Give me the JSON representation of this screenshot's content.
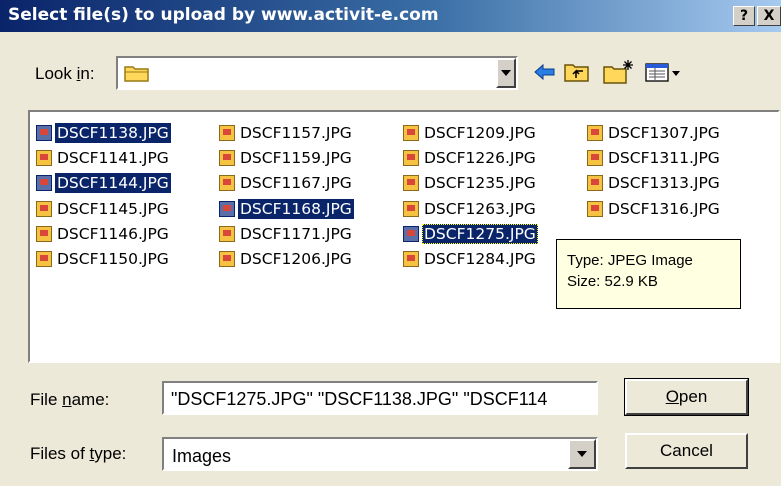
{
  "window": {
    "title": "Select file(s) to upload by www.activit-e.com",
    "help_glyph": "?",
    "close_glyph": "X"
  },
  "toolbar": {
    "look_in_pre": "Look ",
    "look_in_mn": "i",
    "look_in_post": "n:",
    "look_in_value": ""
  },
  "files": [
    {
      "name": "DSCF1138.JPG"
    },
    {
      "name": "DSCF1141.JPG"
    },
    {
      "name": "DSCF1144.JPG"
    },
    {
      "name": "DSCF1145.JPG"
    },
    {
      "name": "DSCF1146.JPG"
    },
    {
      "name": "DSCF1150.JPG"
    },
    {
      "name": "DSCF1157.JPG"
    },
    {
      "name": "DSCF1159.JPG"
    },
    {
      "name": "DSCF1167.JPG"
    },
    {
      "name": "DSCF1168.JPG"
    },
    {
      "name": "DSCF1171.JPG"
    },
    {
      "name": "DSCF1206.JPG"
    },
    {
      "name": "DSCF1209.JPG"
    },
    {
      "name": "DSCF1226.JPG"
    },
    {
      "name": "DSCF1235.JPG"
    },
    {
      "name": "DSCF1263.JPG"
    },
    {
      "name": "DSCF1275.JPG"
    },
    {
      "name": "DSCF1284.JPG"
    },
    {
      "name": "DSCF1307.JPG"
    },
    {
      "name": "DSCF1311.JPG"
    },
    {
      "name": "DSCF1313.JPG"
    },
    {
      "name": "DSCF1316.JPG"
    }
  ],
  "tooltip": {
    "type": "Type: JPEG Image",
    "size": "Size: 52.9 KB"
  },
  "file_name": {
    "pre": "File ",
    "mn": "n",
    "post": "ame:",
    "value": "\"DSCF1275.JPG\" \"DSCF1138.JPG\" \"DSCF114"
  },
  "file_type": {
    "pre": "Files of ",
    "mn": "t",
    "post": "ype:",
    "value": "Images"
  },
  "buttons": {
    "open_mn": "O",
    "open_rest": "pen",
    "cancel": "Cancel"
  },
  "colors": {
    "selection": "#0a246a",
    "dialog_bg": "#ece9d8",
    "tooltip_bg": "#ffffe1"
  }
}
